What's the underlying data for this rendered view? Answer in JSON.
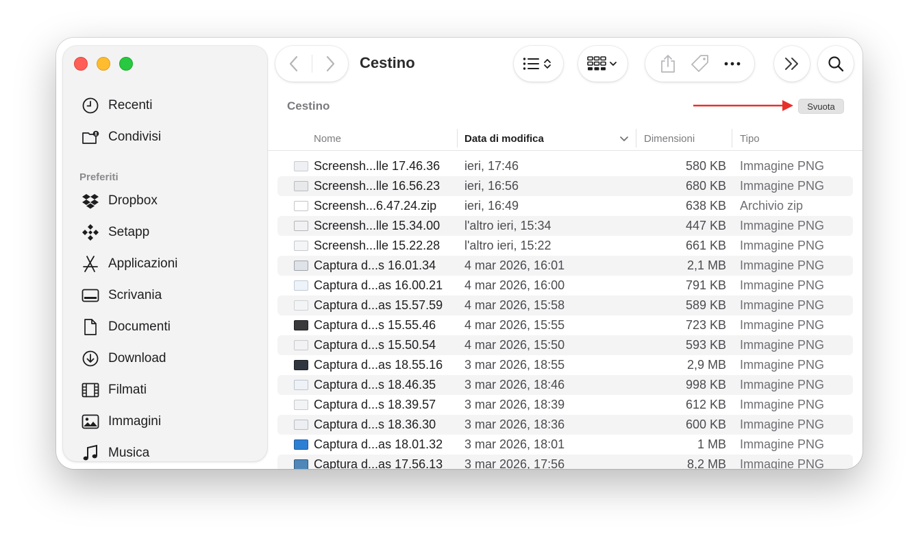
{
  "window": {
    "title": "Cestino"
  },
  "sidebar": {
    "top_items": [
      {
        "label": "Recenti",
        "icon": "clock-icon"
      },
      {
        "label": "Condivisi",
        "icon": "shared-folder-icon"
      }
    ],
    "section_title": "Preferiti",
    "favorites": [
      {
        "label": "Dropbox",
        "icon": "dropbox-icon"
      },
      {
        "label": "Setapp",
        "icon": "setapp-icon"
      },
      {
        "label": "Applicazioni",
        "icon": "applications-icon"
      },
      {
        "label": "Scrivania",
        "icon": "desktop-icon"
      },
      {
        "label": "Documenti",
        "icon": "document-icon"
      },
      {
        "label": "Download",
        "icon": "download-icon"
      },
      {
        "label": "Filmati",
        "icon": "film-icon"
      },
      {
        "label": "Immagini",
        "icon": "photo-icon"
      },
      {
        "label": "Musica",
        "icon": "music-icon"
      }
    ]
  },
  "toolbar": {
    "icons": [
      "back-icon",
      "forward-icon",
      "list-view-icon",
      "gallery-view-icon",
      "share-icon",
      "tag-icon",
      "more-icon",
      "expand-icon",
      "search-icon"
    ]
  },
  "content": {
    "path_title": "Cestino",
    "empty_button": "Svuota",
    "annotation_color": "#e8302a",
    "columns": {
      "name": "Nome",
      "date": "Data di modifica",
      "size": "Dimensioni",
      "kind": "Tipo"
    },
    "sorted_column": "date",
    "files": [
      {
        "name": "Screensh...lle 17.46.36",
        "date": "ieri, 17:46",
        "size": "580 KB",
        "kind": "Immagine PNG"
      },
      {
        "name": "Screensh...lle 16.56.23",
        "date": "ieri, 16:56",
        "size": "680 KB",
        "kind": "Immagine PNG"
      },
      {
        "name": "Screensh...6.47.24.zip",
        "date": "ieri, 16:49",
        "size": "638 KB",
        "kind": "Archivio zip"
      },
      {
        "name": "Screensh...lle 15.34.00",
        "date": "l'altro ieri, 15:34",
        "size": "447 KB",
        "kind": "Immagine PNG"
      },
      {
        "name": "Screensh...lle 15.22.28",
        "date": "l'altro ieri, 15:22",
        "size": "661 KB",
        "kind": "Immagine PNG"
      },
      {
        "name": "Captura d...s 16.01.34",
        "date": "4 mar 2026, 16:01",
        "size": "2,1 MB",
        "kind": "Immagine PNG"
      },
      {
        "name": "Captura d...as 16.00.21",
        "date": "4 mar 2026, 16:00",
        "size": "791 KB",
        "kind": "Immagine PNG"
      },
      {
        "name": "Captura d...as 15.57.59",
        "date": "4 mar 2026, 15:58",
        "size": "589 KB",
        "kind": "Immagine PNG"
      },
      {
        "name": "Captura d...s 15.55.46",
        "date": "4 mar 2026, 15:55",
        "size": "723 KB",
        "kind": "Immagine PNG"
      },
      {
        "name": "Captura d...s 15.50.54",
        "date": "4 mar 2026, 15:50",
        "size": "593 KB",
        "kind": "Immagine PNG"
      },
      {
        "name": "Captura d...as 18.55.16",
        "date": "3 mar 2026, 18:55",
        "size": "2,9 MB",
        "kind": "Immagine PNG"
      },
      {
        "name": "Captura d...s 18.46.35",
        "date": "3 mar 2026, 18:46",
        "size": "998 KB",
        "kind": "Immagine PNG"
      },
      {
        "name": "Captura d...s 18.39.57",
        "date": "3 mar 2026, 18:39",
        "size": "612 KB",
        "kind": "Immagine PNG"
      },
      {
        "name": "Captura d...s 18.36.30",
        "date": "3 mar 2026, 18:36",
        "size": "600 KB",
        "kind": "Immagine PNG"
      },
      {
        "name": "Captura d...as 18.01.32",
        "date": "3 mar 2026, 18:01",
        "size": "1 MB",
        "kind": "Immagine PNG"
      },
      {
        "name": "Captura d...as 17.56.13",
        "date": "3 mar 2026, 17:56",
        "size": "8,2 MB",
        "kind": "Immagine PNG"
      }
    ]
  }
}
